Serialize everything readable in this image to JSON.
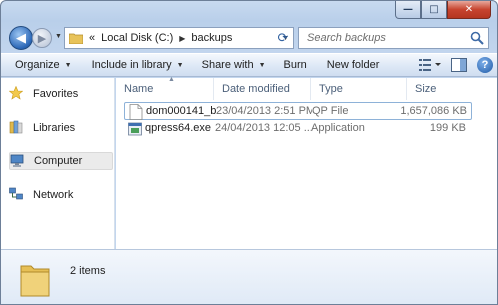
{
  "window": {
    "minimize_label": "—",
    "maximize_label": "□",
    "close_label": "✕"
  },
  "nav": {
    "back_label": "◀",
    "forward_label": "▶"
  },
  "address": {
    "chevrons": "«",
    "segments": [
      "Local Disk (C:)",
      "backups"
    ],
    "separator": "▶"
  },
  "search": {
    "placeholder": "Search backups"
  },
  "toolbar": {
    "organize": "Organize",
    "include_in_library": "Include in library",
    "share_with": "Share with",
    "burn": "Burn",
    "new_folder": "New folder",
    "help": "?"
  },
  "sidebar": {
    "items": [
      {
        "label": "Favorites",
        "icon": "star-icon"
      },
      {
        "label": "Libraries",
        "icon": "libraries-icon"
      },
      {
        "label": "Computer",
        "icon": "computer-icon"
      },
      {
        "label": "Network",
        "icon": "network-icon"
      }
    ]
  },
  "table": {
    "columns": [
      "Name",
      "Date modified",
      "Type",
      "Size"
    ],
    "rows": [
      {
        "name": "dom000141_b...",
        "date": "23/04/2013 2:51 PM",
        "type": "QP File",
        "size": "1,657,086 KB"
      },
      {
        "name": "qpress64.exe",
        "date": "24/04/2013 12:05 ...",
        "type": "Application",
        "size": "199 KB"
      }
    ]
  },
  "details": {
    "item_count": "2 items"
  },
  "colors": {
    "title_gradient": "#c3d6ee",
    "close_button": "#c7442f",
    "selection_border": "#8eb2d8"
  }
}
